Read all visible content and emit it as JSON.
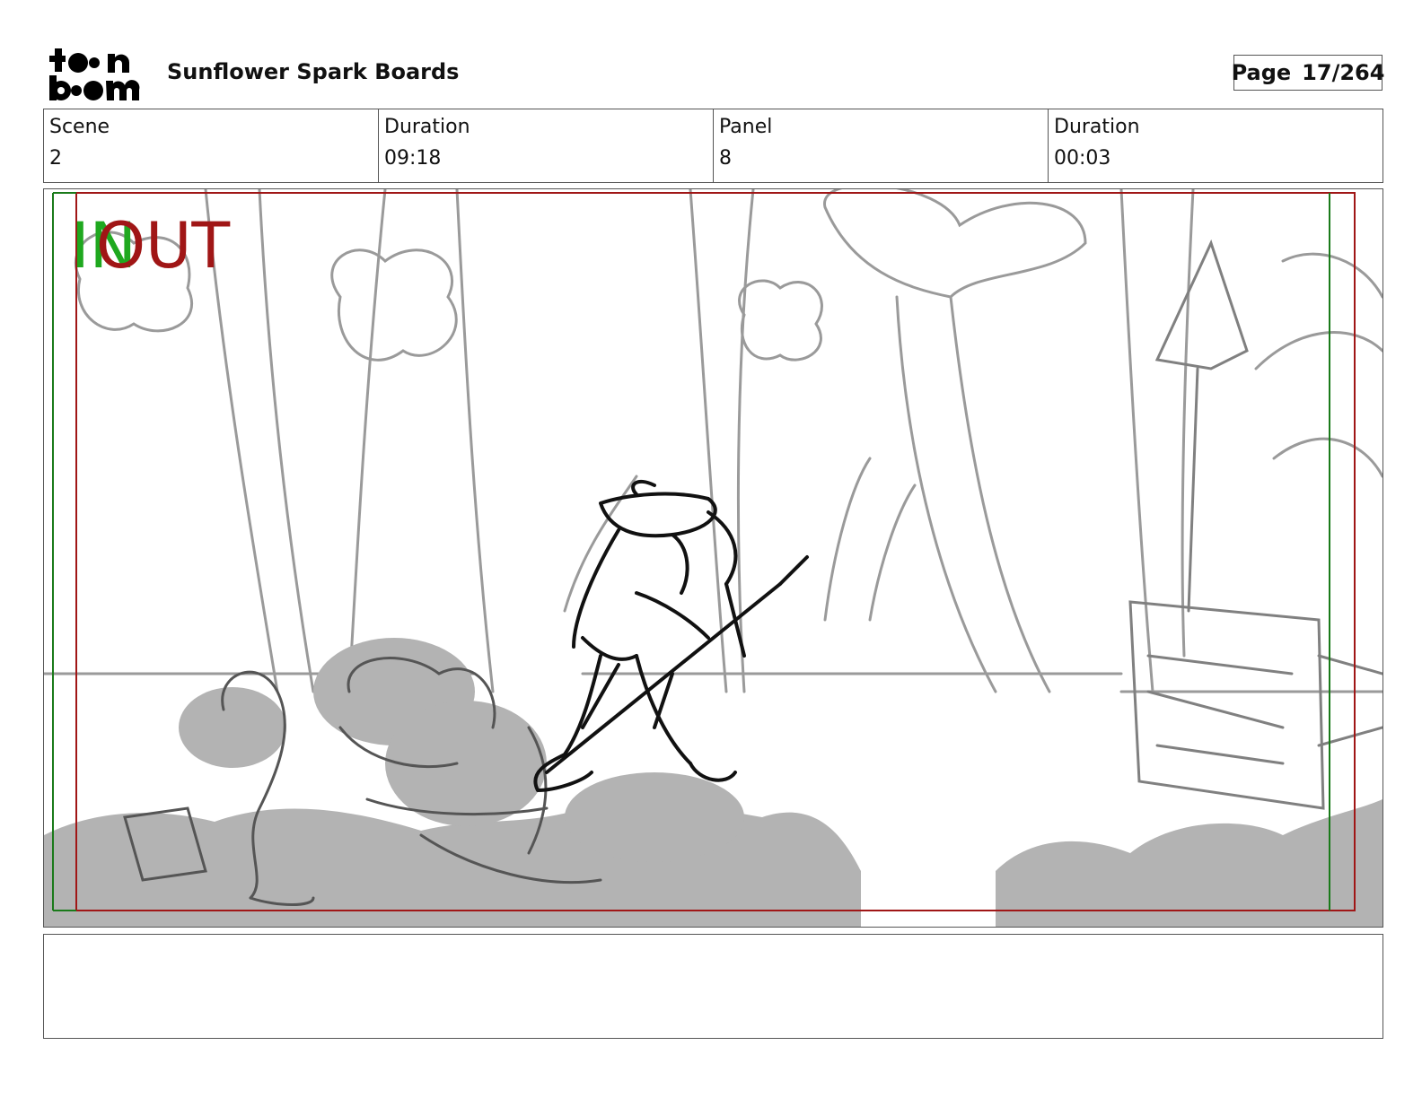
{
  "header": {
    "logo_icon": "toonboom-logo",
    "project_title": "Sunflower Spark Boards",
    "page_label": "Page",
    "page_value": "17/264"
  },
  "info": {
    "scene_label": "Scene",
    "scene_value": "2",
    "scene_duration_label": "Duration",
    "scene_duration_value": "09:18",
    "panel_label": "Panel",
    "panel_value": "8",
    "panel_duration_label": "Duration",
    "panel_duration_value": "00:03"
  },
  "panel": {
    "in_marker": "IN",
    "out_marker": "OUT",
    "in_color": "#1fa81f",
    "out_color": "#a01616",
    "image": "storyboard-sketch-forest-characters-sign"
  },
  "notes": {
    "text": ""
  }
}
